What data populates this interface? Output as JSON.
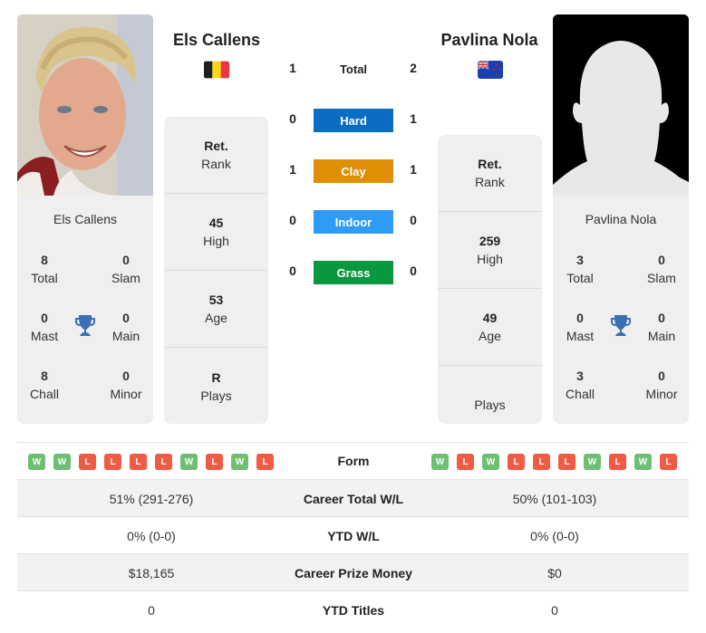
{
  "player1": {
    "name": "Els Callens",
    "country_flag": "belgium-flag",
    "photo": "player-photo",
    "card_name": "Els Callens",
    "titles": {
      "total": {
        "value": "8",
        "label": "Total"
      },
      "slam": {
        "value": "0",
        "label": "Slam"
      },
      "mast": {
        "value": "0",
        "label": "Mast"
      },
      "main": {
        "value": "0",
        "label": "Main"
      },
      "chall": {
        "value": "8",
        "label": "Chall"
      },
      "minor": {
        "value": "0",
        "label": "Minor"
      }
    },
    "info": [
      {
        "value": "Ret.",
        "label": "Rank"
      },
      {
        "value": "45",
        "label": "High"
      },
      {
        "value": "53",
        "label": "Age"
      },
      {
        "value": "R",
        "label": "Plays"
      }
    ],
    "form": [
      "W",
      "W",
      "L",
      "L",
      "L",
      "L",
      "W",
      "L",
      "W",
      "L"
    ]
  },
  "player2": {
    "name": "Pavlina Nola",
    "country_flag": "new-zealand-flag",
    "photo": "placeholder-silhouette",
    "card_name": "Pavlina Nola",
    "titles": {
      "total": {
        "value": "3",
        "label": "Total"
      },
      "slam": {
        "value": "0",
        "label": "Slam"
      },
      "mast": {
        "value": "0",
        "label": "Mast"
      },
      "main": {
        "value": "0",
        "label": "Main"
      },
      "chall": {
        "value": "3",
        "label": "Chall"
      },
      "minor": {
        "value": "0",
        "label": "Minor"
      }
    },
    "info": [
      {
        "value": "Ret.",
        "label": "Rank"
      },
      {
        "value": "259",
        "label": "High"
      },
      {
        "value": "49",
        "label": "Age"
      },
      {
        "value": "",
        "label": "Plays"
      }
    ],
    "form": [
      "W",
      "L",
      "W",
      "L",
      "L",
      "L",
      "W",
      "L",
      "W",
      "L"
    ]
  },
  "h2h": {
    "total": {
      "label": "Total",
      "p1": "1",
      "p2": "2"
    },
    "surfaces": [
      {
        "label": "Hard",
        "p1": "0",
        "p2": "1",
        "color": "#0a6cc2"
      },
      {
        "label": "Clay",
        "p1": "1",
        "p2": "1",
        "color": "#df8f05"
      },
      {
        "label": "Indoor",
        "p1": "0",
        "p2": "0",
        "color": "#2e9cf4"
      },
      {
        "label": "Grass",
        "p1": "0",
        "p2": "0",
        "color": "#0a983e"
      }
    ]
  },
  "form_label": "Form",
  "stats": [
    {
      "label": "Career Total W/L",
      "p1": "51% (291-276)",
      "p2": "50% (101-103)"
    },
    {
      "label": "YTD W/L",
      "p1": "0% (0-0)",
      "p2": "0% (0-0)"
    },
    {
      "label": "Career Prize Money",
      "p1": "$18,165",
      "p2": "$0"
    },
    {
      "label": "YTD Titles",
      "p1": "0",
      "p2": "0"
    }
  ],
  "colors": {
    "win": "#6fbf73",
    "loss": "#ef5b45",
    "trophy": "#3a6fb5",
    "card_bg": "#efefef"
  }
}
